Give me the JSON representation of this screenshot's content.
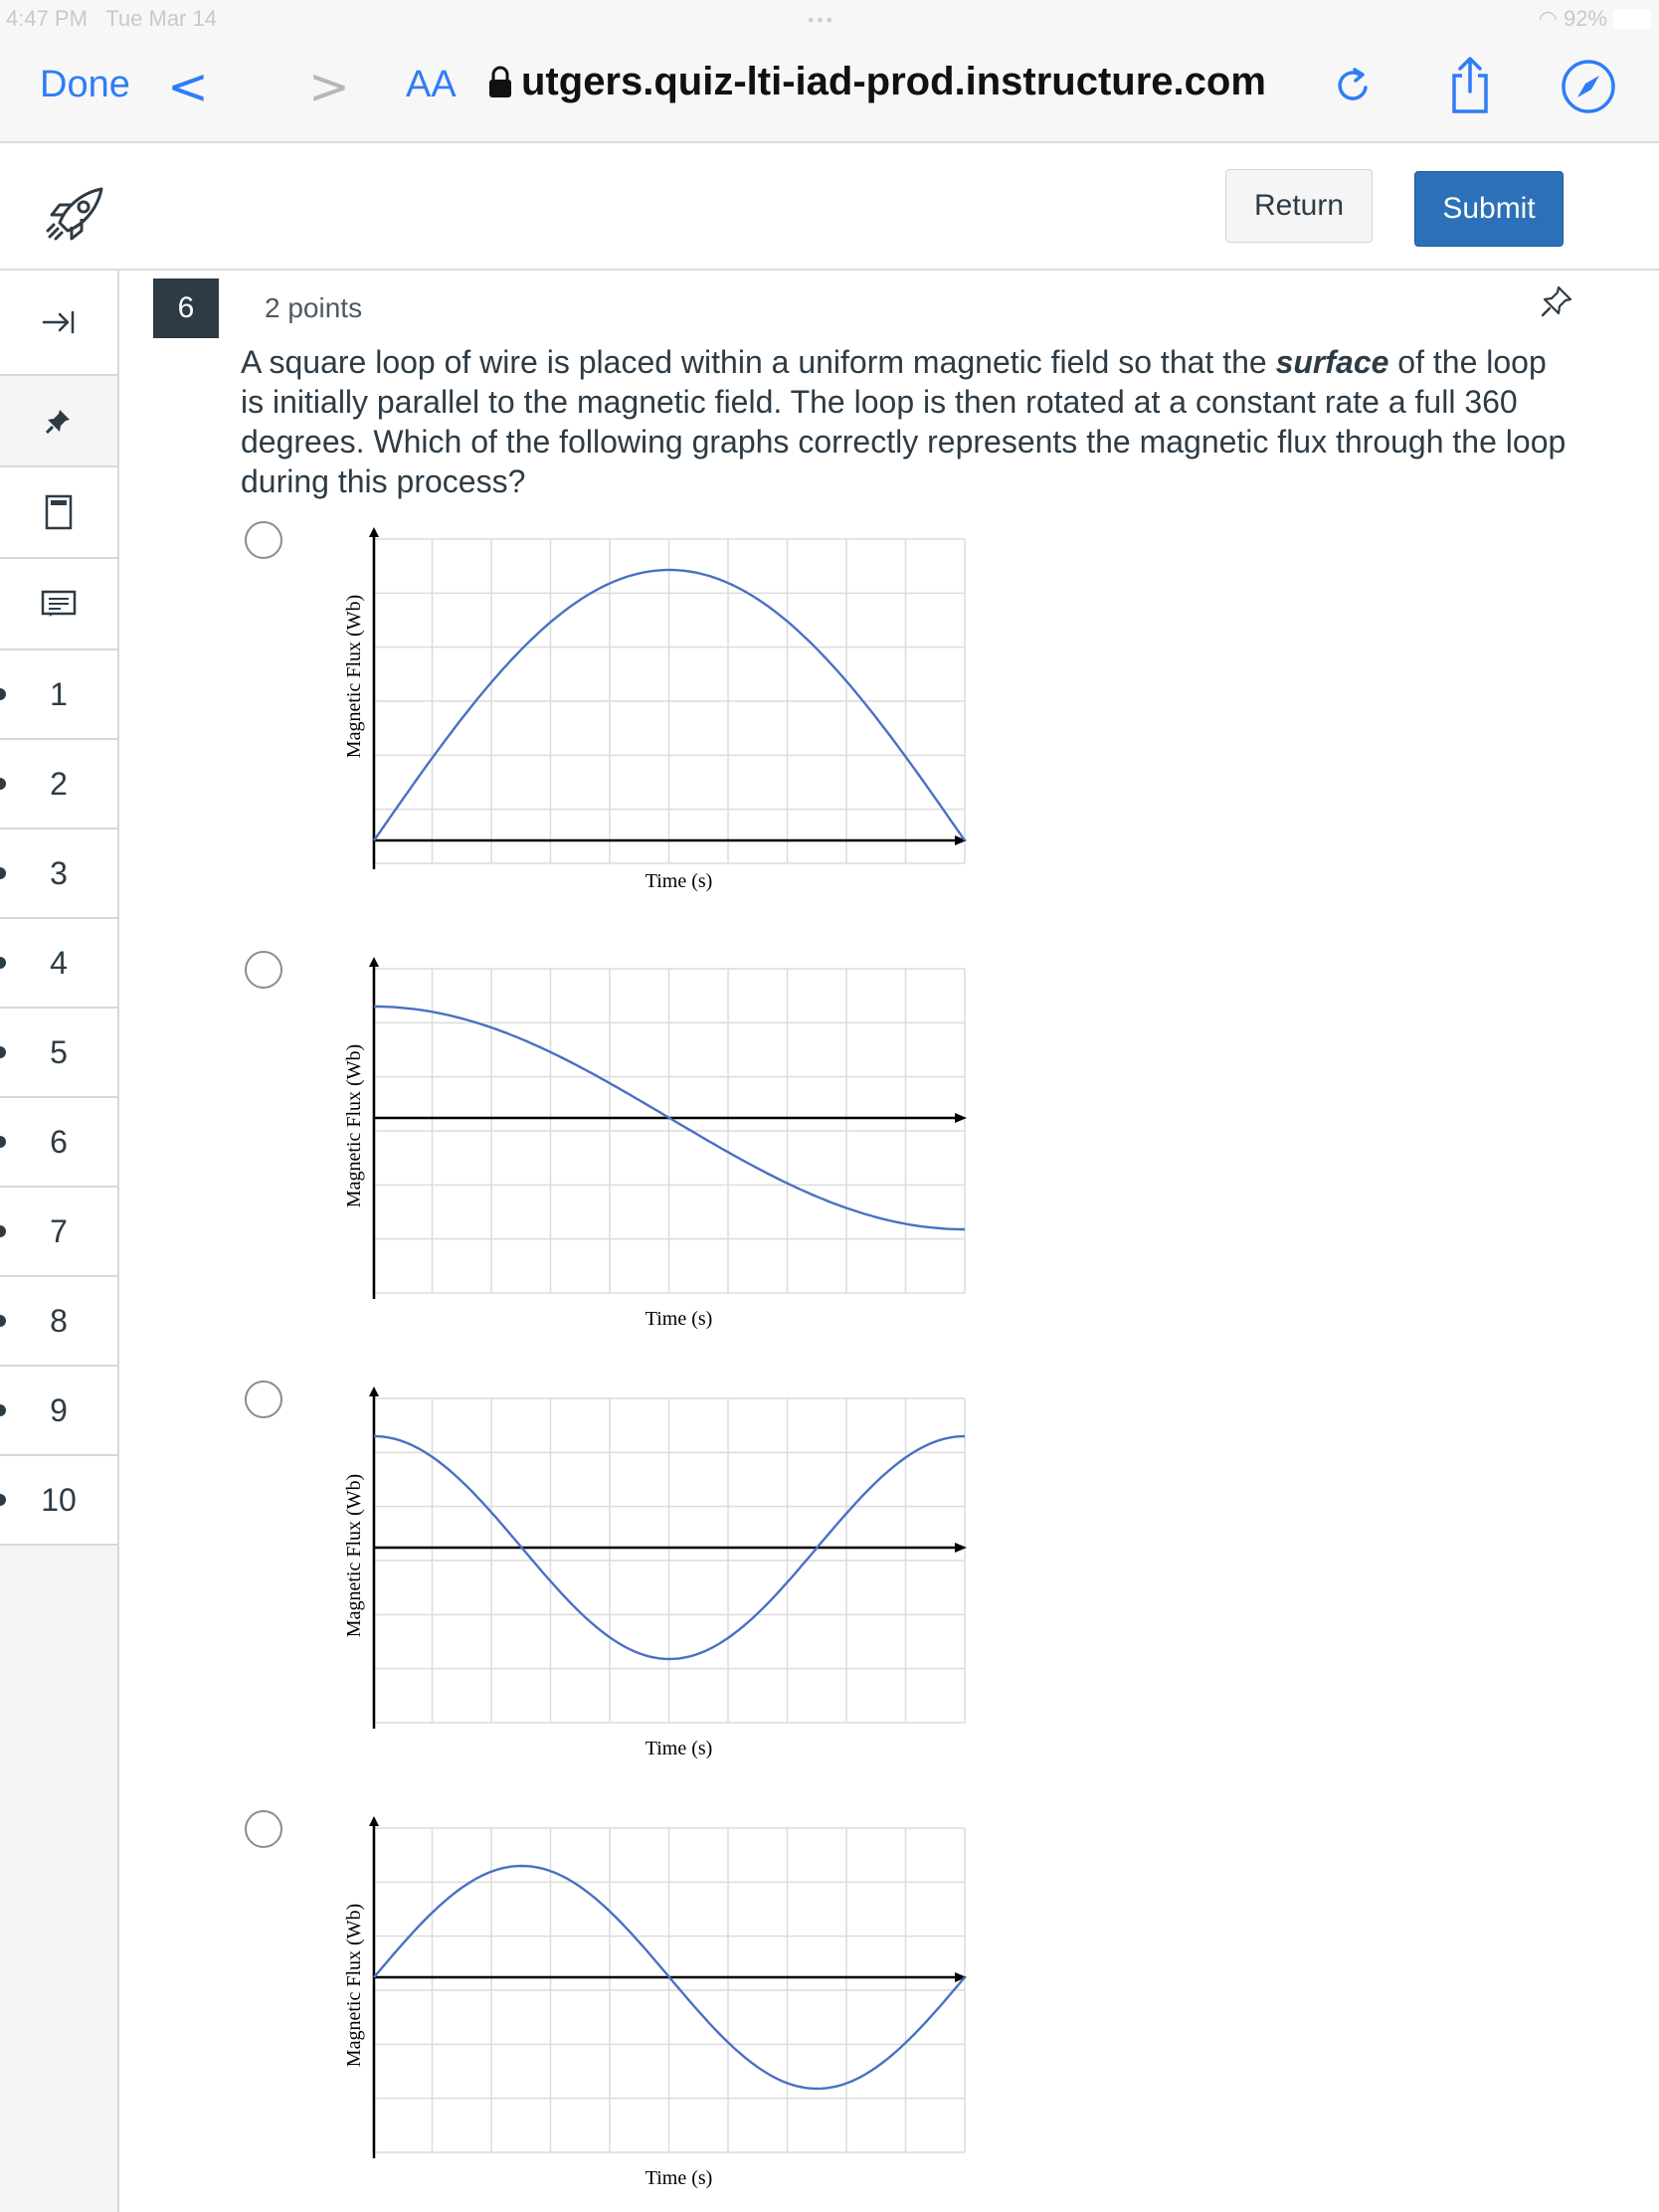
{
  "status_bar": {
    "time": "4:47 PM",
    "date": "Tue Mar 14",
    "battery": "92%"
  },
  "browser": {
    "done_label": "Done",
    "text_size_label": "AA",
    "url": "utgers.quiz-lti-iad-prod.instructure.com",
    "icons": [
      "back-chevron-icon",
      "forward-chevron-icon",
      "lock-icon",
      "reload-icon",
      "share-icon",
      "compass-icon"
    ]
  },
  "header": {
    "return_label": "Return",
    "submit_label": "Submit",
    "accent": "#2c71b8"
  },
  "sidebar": {
    "icons": [
      "collapse-arrow-icon",
      "pin-icon",
      "calculator-icon",
      "notes-icon"
    ],
    "questions": [
      "1",
      "2",
      "3",
      "4",
      "5",
      "6",
      "7",
      "8",
      "9",
      "10"
    ]
  },
  "question": {
    "number": "6",
    "points": "2 points",
    "text_before": "A square loop of wire is placed within a uniform magnetic field so that the ",
    "text_emph": "surface",
    "text_after": " of the loop is initially parallel to the magnetic field. The loop is then rotated at a constant rate a full 360 degrees. Which of the following graphs correctly represents the magnetic flux through the loop during this process?"
  },
  "chart_data": [
    {
      "type": "line",
      "xlabel": "Time (s)",
      "ylabel": "Magnetic Flux (Wb)",
      "x": [
        0,
        0.5,
        1
      ],
      "series": [
        {
          "values": [
            0,
            1,
            0
          ],
          "shape": "half-sine |sin|"
        }
      ],
      "color": "#4a70c4"
    },
    {
      "type": "line",
      "xlabel": "Time (s)",
      "ylabel": "Magnetic Flux (Wb)",
      "x": [
        0,
        0.5,
        1
      ],
      "series": [
        {
          "values": [
            1,
            0,
            -1
          ],
          "shape": "half-cosine"
        }
      ],
      "color": "#4a70c4"
    },
    {
      "type": "line",
      "xlabel": "Time (s)",
      "ylabel": "Magnetic Flux (Wb)",
      "x": [
        0,
        0.25,
        0.5,
        0.75,
        1
      ],
      "series": [
        {
          "values": [
            1,
            0,
            -1,
            0,
            1
          ],
          "shape": "full cosine"
        }
      ],
      "color": "#4a70c4"
    },
    {
      "type": "line",
      "xlabel": "Time (s)",
      "ylabel": "Magnetic Flux (Wb)",
      "x": [
        0,
        0.25,
        0.5,
        0.75,
        1
      ],
      "series": [
        {
          "values": [
            0,
            1,
            0,
            -1,
            0
          ],
          "shape": "full sine"
        }
      ],
      "color": "#4a70c4"
    }
  ]
}
